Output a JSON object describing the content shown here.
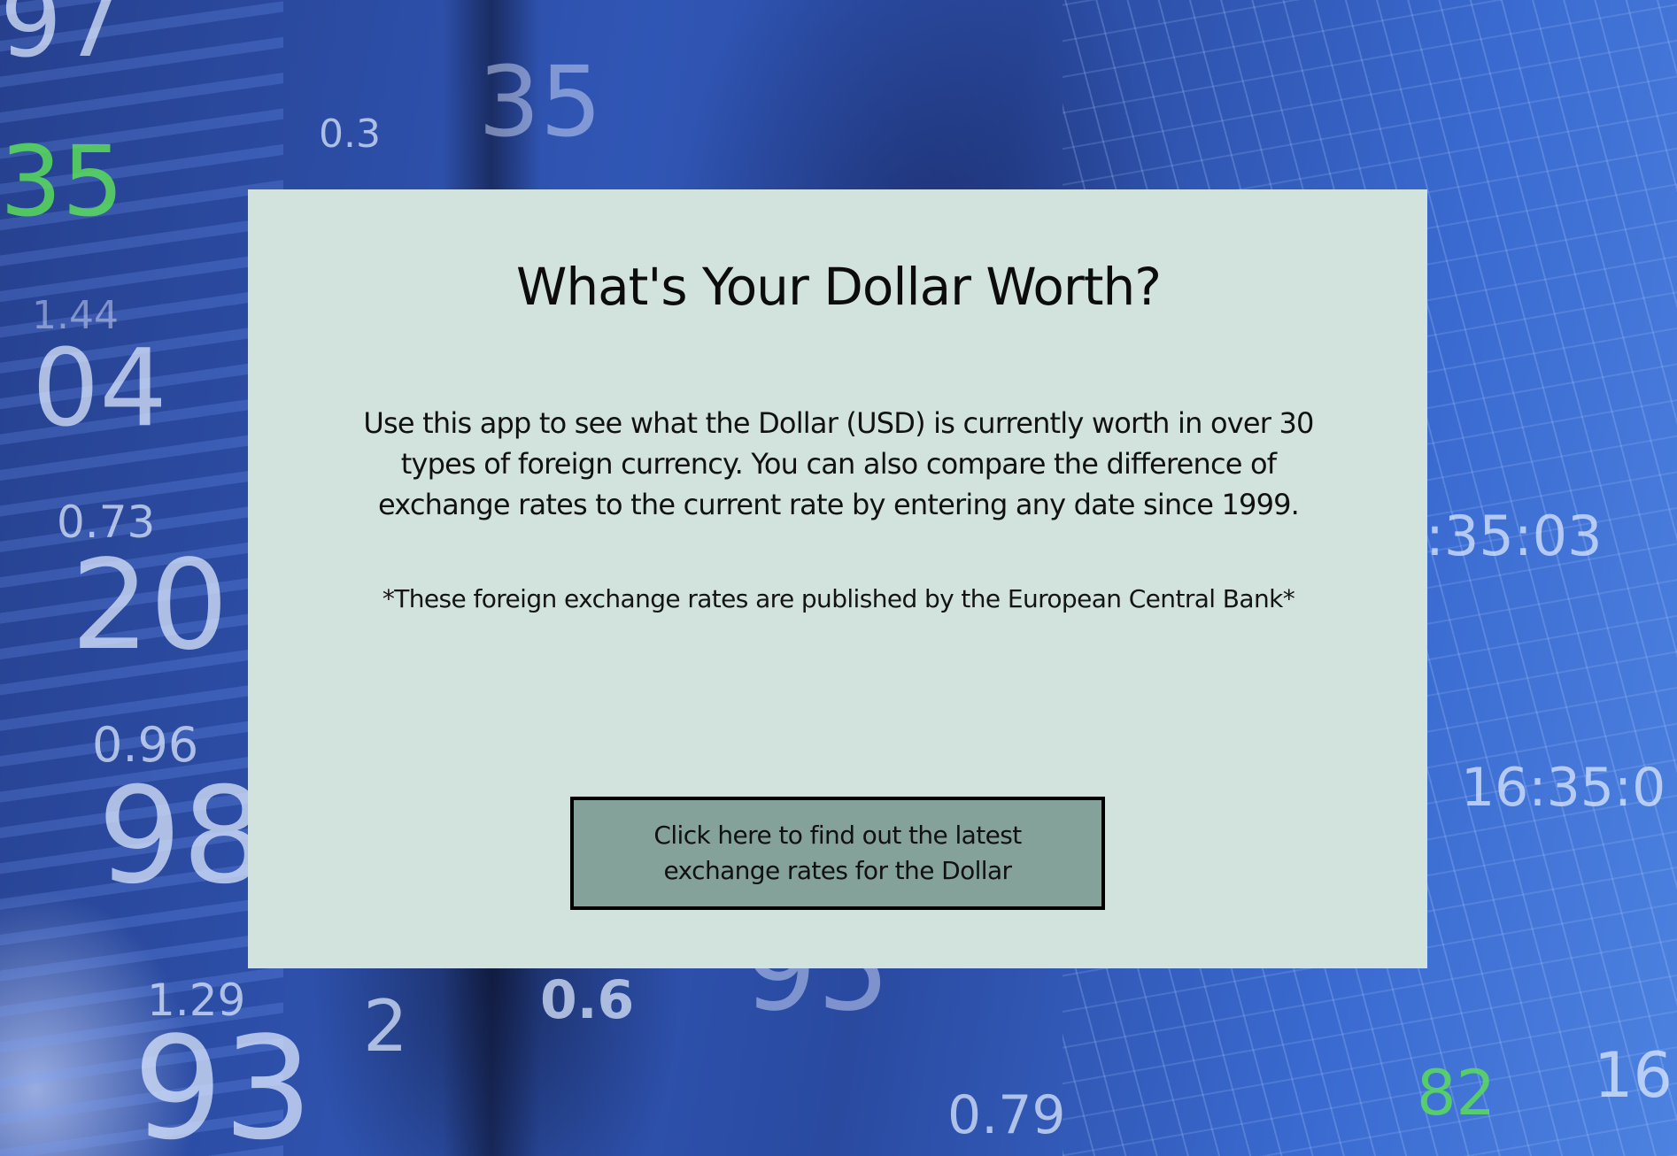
{
  "background": {
    "ticker_numbers": [
      "97",
      "35",
      "35",
      "0.3",
      "1.44",
      "04",
      "0.73",
      "20",
      "0.96",
      "98",
      "1.29",
      "93",
      "2",
      "0.6",
      "95",
      "0.79",
      ":35:03",
      "16:35:0",
      "16",
      "82"
    ],
    "colors": {
      "primary_blue": "#2a4aa0",
      "highlight_green": "#5adc5a"
    }
  },
  "card": {
    "background_color": "#d1e3dc",
    "title": "What's Your Dollar Worth?",
    "intro": "Use this app to see what the Dollar (USD) is currently worth in over 30 types of foreign currency. You can also compare the difference of exchange rates to the current rate by entering any date since 1999.",
    "note": "*These foreign exchange rates are published by the European Central Bank*",
    "cta_label": "Click here to find out the latest exchange rates for the Dollar",
    "cta_color": "#84a19a"
  }
}
